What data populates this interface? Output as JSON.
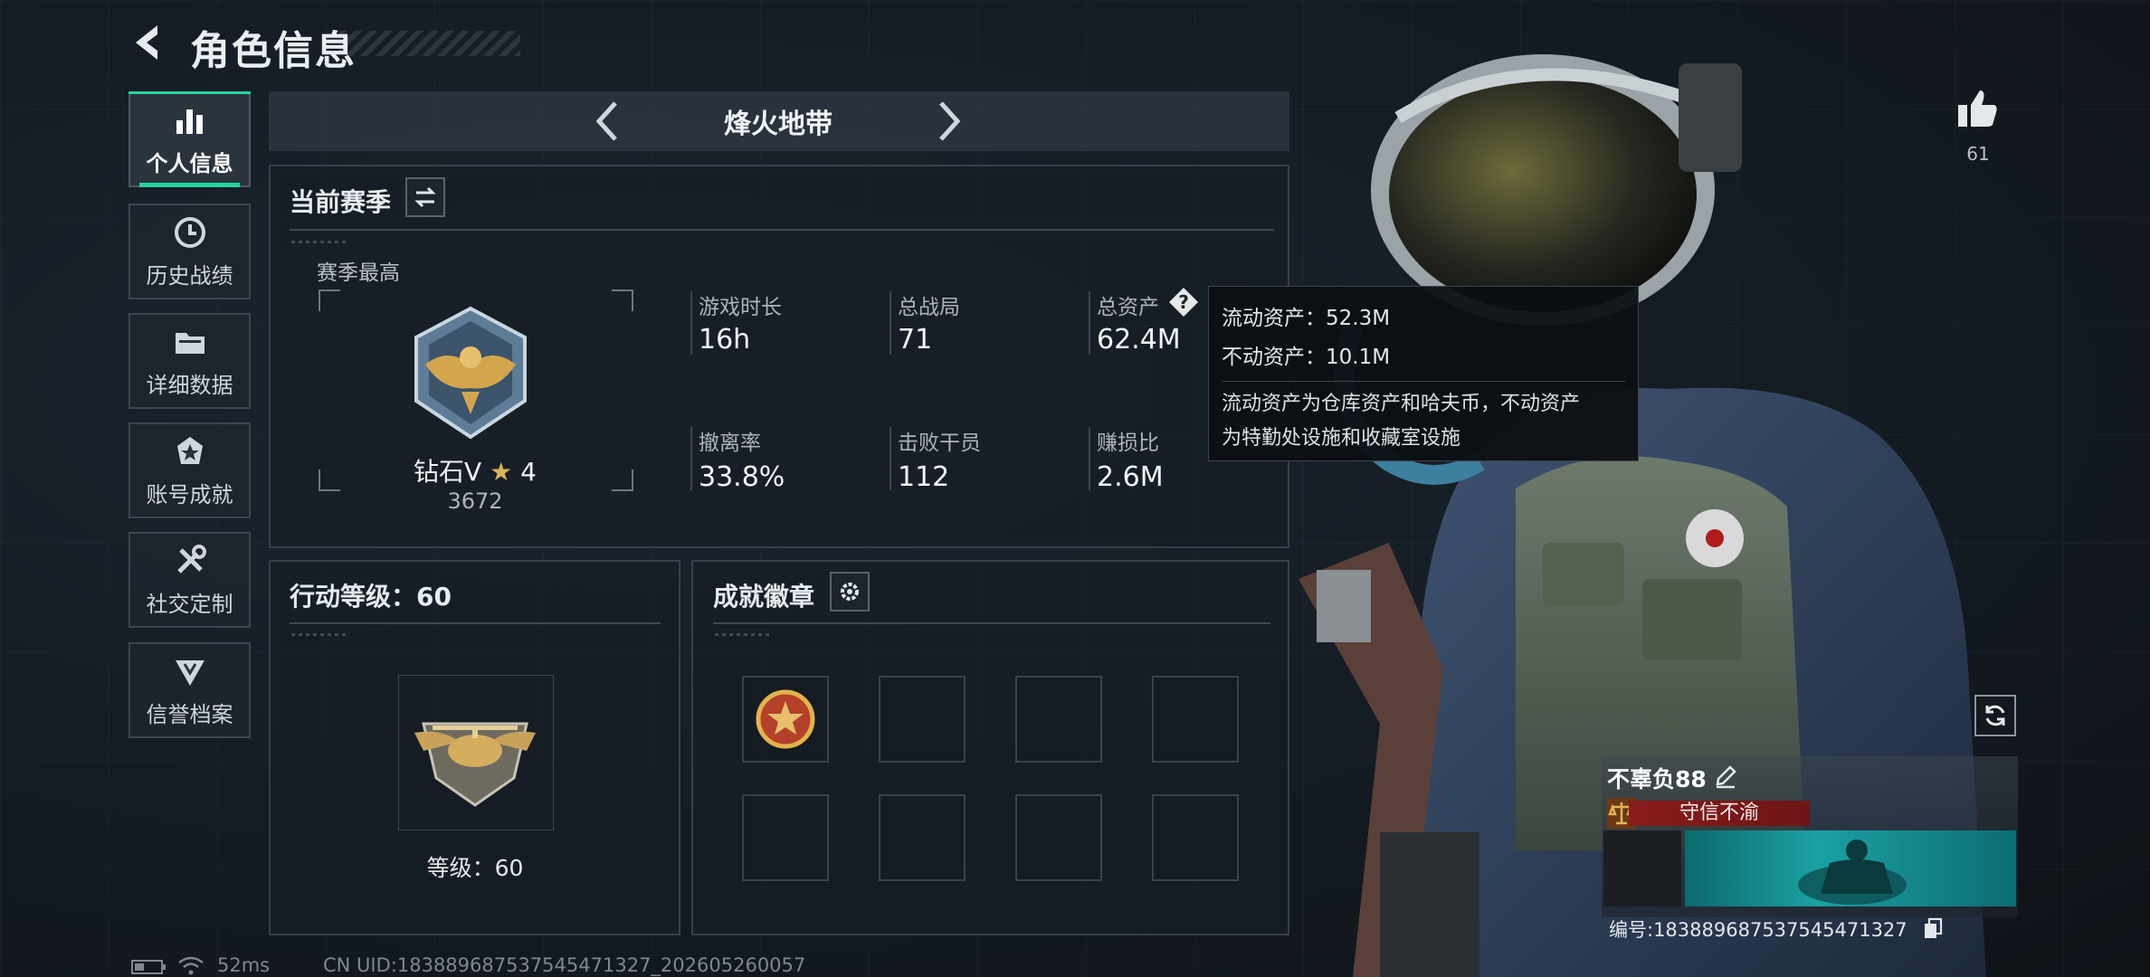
{
  "header": {
    "title": "角色信息"
  },
  "sidebar": {
    "items": [
      {
        "label": "个人信息",
        "icon": "bar-chart-icon",
        "active": true
      },
      {
        "label": "历史战绩",
        "icon": "history-clock-icon"
      },
      {
        "label": "详细数据",
        "icon": "folder-icon"
      },
      {
        "label": "账号成就",
        "icon": "achievement-icon"
      },
      {
        "label": "社交定制",
        "icon": "tools-icon"
      },
      {
        "label": "信誉档案",
        "icon": "credit-icon"
      }
    ]
  },
  "mode": {
    "title": "烽火地带"
  },
  "season": {
    "title": "当前赛季",
    "peak_label": "赛季最高",
    "rank_name": "钻石V",
    "rank_stars": "4",
    "rank_score": "3672",
    "stats": [
      {
        "label": "游戏时长",
        "value": "16h"
      },
      {
        "label": "总战局",
        "value": "71"
      },
      {
        "label": "总资产",
        "value": "62.4M"
      },
      {
        "label": "撤离率",
        "value": "33.8%"
      },
      {
        "label": "击败干员",
        "value": "112"
      },
      {
        "label": "赚损比",
        "value": "2.6M"
      }
    ]
  },
  "tooltip": {
    "liquid": "流动资产：52.3M",
    "fixed": "不动资产：10.1M",
    "desc_line1": "流动资产为仓库资产和哈夫币，不动资产",
    "desc_line2": "为特勤处设施和收藏室设施"
  },
  "action_level": {
    "title": "行动等级：60",
    "level_label": "等级：60"
  },
  "badges": {
    "title": "成就徽章",
    "slots": 8,
    "filled": 1
  },
  "profile": {
    "like_count": "61",
    "nickname": "不辜负88",
    "reputation": "守信不渝",
    "uid_line": "编号:18388968753754547132​7"
  },
  "status_bar": {
    "ping": "52ms",
    "cn_uid": "CN UID:18388968753754547132​7_202605260057"
  },
  "colors": {
    "accent": "#23d49a",
    "reputation_red": "#8a1c1c",
    "banner_teal": "#1aa1a3"
  }
}
